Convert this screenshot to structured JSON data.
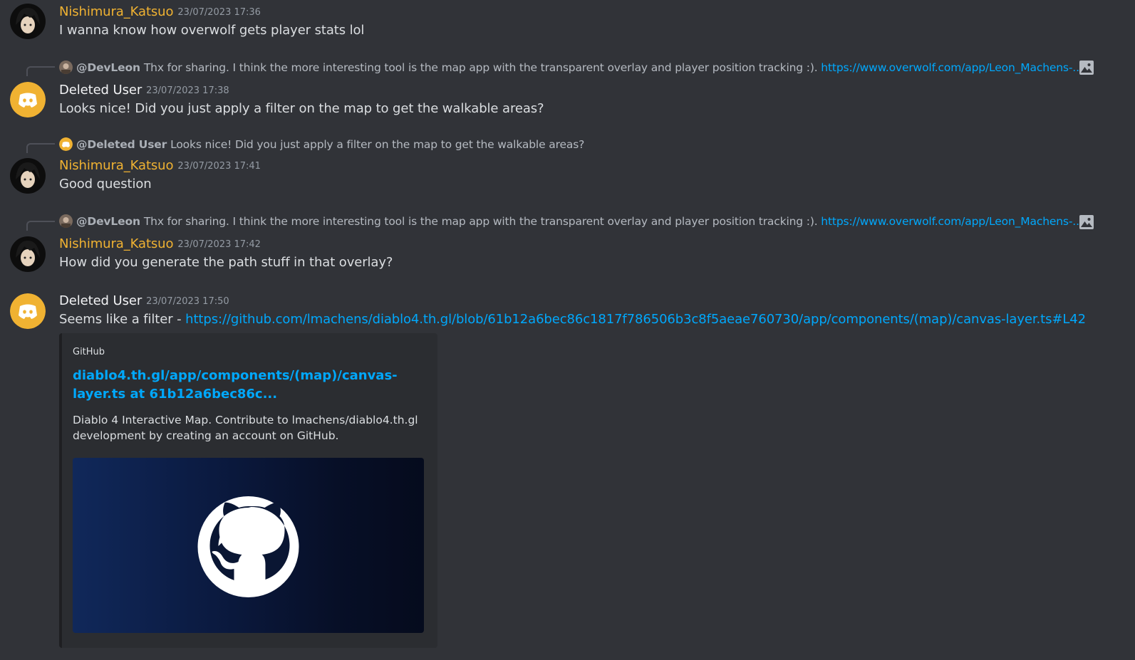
{
  "colors": {
    "background": "#313338",
    "username_yellow": "#f0b232",
    "link": "#00a8fc",
    "deleted_user_avatar": "#f0b232"
  },
  "messages": [
    {
      "author": "Nishimura_Katsuo",
      "timestamp": "23/07/2023 17:36",
      "text": "I wanna know how overwolf gets player stats lol"
    },
    {
      "reply": {
        "mention": "@DevLeon",
        "text": "Thx for sharing. I think the more interesting tool is the map app with the transparent overlay and player position tracking  :).",
        "link": "https://www.overwolf.com/app/Leon_Machens-...",
        "icon": "image-icon"
      },
      "author": "Deleted User",
      "timestamp": "23/07/2023 17:38",
      "text": "Looks nice! Did you just apply a filter on the map to get the walkable areas?"
    },
    {
      "reply": {
        "mention": "@Deleted User",
        "text": "Looks nice! Did you just apply a filter on the map to get the walkable areas?"
      },
      "author": "Nishimura_Katsuo",
      "timestamp": "23/07/2023 17:41",
      "text": "Good question"
    },
    {
      "reply": {
        "mention": "@DevLeon",
        "text": "Thx for sharing. I think the more interesting tool is the map app with the transparent overlay and player position tracking  :).",
        "link": "https://www.overwolf.com/app/Leon_Machens-...",
        "icon": "image-icon"
      },
      "author": "Nishimura_Katsuo",
      "timestamp": "23/07/2023 17:42",
      "text": "How did you generate the path stuff in that overlay?"
    },
    {
      "author": "Deleted User",
      "timestamp": "23/07/2023 17:50",
      "text_prefix": "Seems like a filter - ",
      "link": "https://github.com/lmachens/diablo4.th.gl/blob/61b12a6bec86c1817f786506b3c8f5aeae760730/app/components/(map)/canvas-layer.ts#L42"
    }
  ],
  "embed": {
    "provider": "GitHub",
    "title": "diablo4.th.gl/app/components/(map)/canvas-layer.ts at 61b12a6bec86c...",
    "description": "Diablo 4 Interactive Map. Contribute to lmachens/diablo4.th.gl development by creating an account on GitHub.",
    "image_icon": "github-logo-icon"
  }
}
